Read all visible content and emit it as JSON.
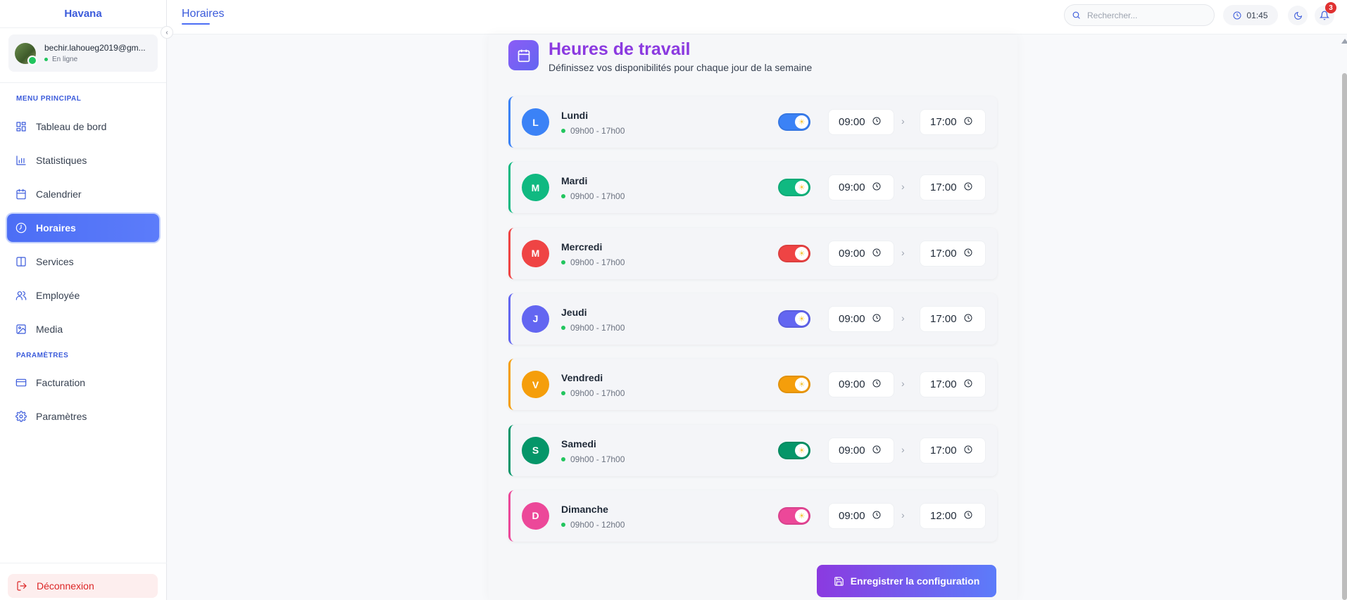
{
  "sidebar": {
    "brand": "Havana",
    "user": {
      "email": "bechir.lahoueg2019@gm...",
      "status": "En ligne"
    },
    "section_main": "MENU PRINCIPAL",
    "items": [
      {
        "label": "Tableau de bord",
        "icon": "dashboard-icon"
      },
      {
        "label": "Statistiques",
        "icon": "bar-chart-icon"
      },
      {
        "label": "Calendrier",
        "icon": "calendar-icon"
      },
      {
        "label": "Horaires",
        "icon": "clock-icon",
        "active": true
      },
      {
        "label": "Services",
        "icon": "book-icon"
      },
      {
        "label": "Employée",
        "icon": "users-icon"
      },
      {
        "label": "Media",
        "icon": "image-icon"
      }
    ],
    "section_settings": "PARAMÈTRES",
    "settings_items": [
      {
        "label": "Facturation",
        "icon": "credit-card-icon"
      },
      {
        "label": "Paramètres",
        "icon": "gear-icon"
      }
    ],
    "logout": "Déconnexion"
  },
  "header": {
    "title": "Horaires",
    "search_placeholder": "Rechercher...",
    "time": "01:45",
    "notifications": "3"
  },
  "main": {
    "title": "Heures de travail",
    "subtitle": "Définissez vos disponibilités pour chaque jour de la semaine",
    "days": [
      {
        "initial": "L",
        "name": "Lundi",
        "hours": "09h00 - 17h00",
        "start": "09:00",
        "end": "17:00",
        "color": "#3b82f6",
        "enabled": true
      },
      {
        "initial": "M",
        "name": "Mardi",
        "hours": "09h00 - 17h00",
        "start": "09:00",
        "end": "17:00",
        "color": "#10b981",
        "enabled": true
      },
      {
        "initial": "M",
        "name": "Mercredi",
        "hours": "09h00 - 17h00",
        "start": "09:00",
        "end": "17:00",
        "color": "#ef4444",
        "enabled": true
      },
      {
        "initial": "J",
        "name": "Jeudi",
        "hours": "09h00 - 17h00",
        "start": "09:00",
        "end": "17:00",
        "color": "#6366f1",
        "enabled": true
      },
      {
        "initial": "V",
        "name": "Vendredi",
        "hours": "09h00 - 17h00",
        "start": "09:00",
        "end": "17:00",
        "color": "#f59e0b",
        "enabled": true
      },
      {
        "initial": "S",
        "name": "Samedi",
        "hours": "09h00 - 17h00",
        "start": "09:00",
        "end": "17:00",
        "color": "#059669",
        "enabled": true
      },
      {
        "initial": "D",
        "name": "Dimanche",
        "hours": "09h00 - 12h00",
        "start": "09:00",
        "end": "12:00",
        "color": "#ec4899",
        "enabled": true
      }
    ],
    "save_label": "Enregistrer la configuration"
  }
}
